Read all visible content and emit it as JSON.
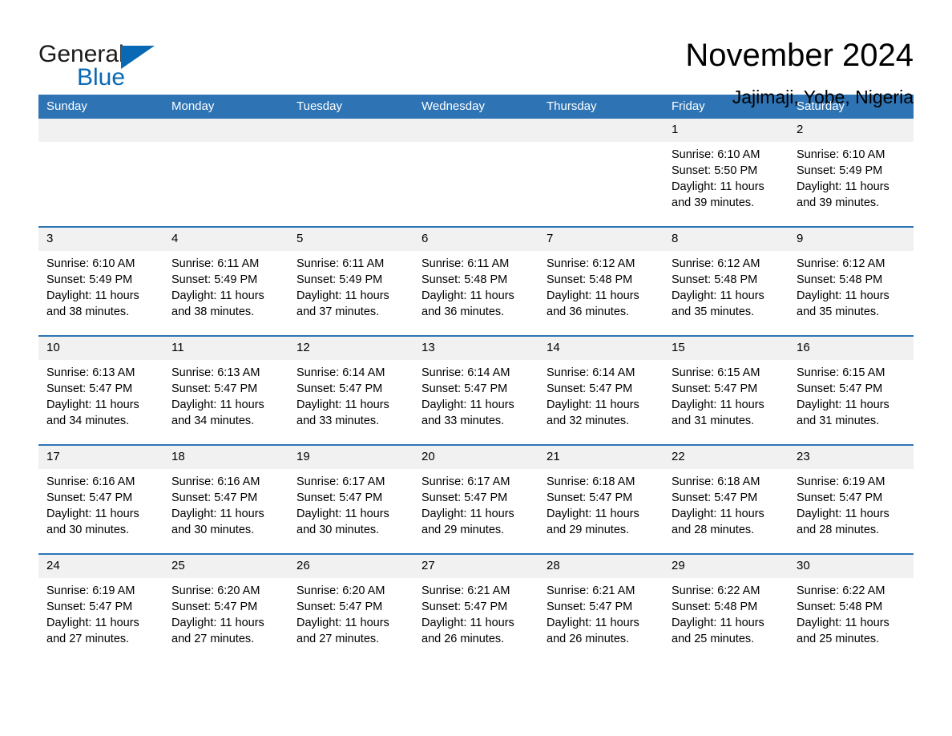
{
  "brand": {
    "word1": "General",
    "word2": "Blue",
    "accent_color": "#0a69b4",
    "triangle_icon": "brand-triangle-icon"
  },
  "header": {
    "month_title": "November 2024",
    "location": "Jajimaji, Yobe, Nigeria"
  },
  "theme": {
    "header_blue": "#2e74b5",
    "daynum_gray": "#f1f1f1",
    "text": "#000000"
  },
  "calendar": {
    "day_names": [
      "Sunday",
      "Monday",
      "Tuesday",
      "Wednesday",
      "Thursday",
      "Friday",
      "Saturday"
    ],
    "weeks": [
      [
        {
          "day": "",
          "lines": []
        },
        {
          "day": "",
          "lines": []
        },
        {
          "day": "",
          "lines": []
        },
        {
          "day": "",
          "lines": []
        },
        {
          "day": "",
          "lines": []
        },
        {
          "day": "1",
          "lines": [
            "Sunrise: 6:10 AM",
            "Sunset: 5:50 PM",
            "Daylight: 11 hours",
            "and 39 minutes."
          ]
        },
        {
          "day": "2",
          "lines": [
            "Sunrise: 6:10 AM",
            "Sunset: 5:49 PM",
            "Daylight: 11 hours",
            "and 39 minutes."
          ]
        }
      ],
      [
        {
          "day": "3",
          "lines": [
            "Sunrise: 6:10 AM",
            "Sunset: 5:49 PM",
            "Daylight: 11 hours",
            "and 38 minutes."
          ]
        },
        {
          "day": "4",
          "lines": [
            "Sunrise: 6:11 AM",
            "Sunset: 5:49 PM",
            "Daylight: 11 hours",
            "and 38 minutes."
          ]
        },
        {
          "day": "5",
          "lines": [
            "Sunrise: 6:11 AM",
            "Sunset: 5:49 PM",
            "Daylight: 11 hours",
            "and 37 minutes."
          ]
        },
        {
          "day": "6",
          "lines": [
            "Sunrise: 6:11 AM",
            "Sunset: 5:48 PM",
            "Daylight: 11 hours",
            "and 36 minutes."
          ]
        },
        {
          "day": "7",
          "lines": [
            "Sunrise: 6:12 AM",
            "Sunset: 5:48 PM",
            "Daylight: 11 hours",
            "and 36 minutes."
          ]
        },
        {
          "day": "8",
          "lines": [
            "Sunrise: 6:12 AM",
            "Sunset: 5:48 PM",
            "Daylight: 11 hours",
            "and 35 minutes."
          ]
        },
        {
          "day": "9",
          "lines": [
            "Sunrise: 6:12 AM",
            "Sunset: 5:48 PM",
            "Daylight: 11 hours",
            "and 35 minutes."
          ]
        }
      ],
      [
        {
          "day": "10",
          "lines": [
            "Sunrise: 6:13 AM",
            "Sunset: 5:47 PM",
            "Daylight: 11 hours",
            "and 34 minutes."
          ]
        },
        {
          "day": "11",
          "lines": [
            "Sunrise: 6:13 AM",
            "Sunset: 5:47 PM",
            "Daylight: 11 hours",
            "and 34 minutes."
          ]
        },
        {
          "day": "12",
          "lines": [
            "Sunrise: 6:14 AM",
            "Sunset: 5:47 PM",
            "Daylight: 11 hours",
            "and 33 minutes."
          ]
        },
        {
          "day": "13",
          "lines": [
            "Sunrise: 6:14 AM",
            "Sunset: 5:47 PM",
            "Daylight: 11 hours",
            "and 33 minutes."
          ]
        },
        {
          "day": "14",
          "lines": [
            "Sunrise: 6:14 AM",
            "Sunset: 5:47 PM",
            "Daylight: 11 hours",
            "and 32 minutes."
          ]
        },
        {
          "day": "15",
          "lines": [
            "Sunrise: 6:15 AM",
            "Sunset: 5:47 PM",
            "Daylight: 11 hours",
            "and 31 minutes."
          ]
        },
        {
          "day": "16",
          "lines": [
            "Sunrise: 6:15 AM",
            "Sunset: 5:47 PM",
            "Daylight: 11 hours",
            "and 31 minutes."
          ]
        }
      ],
      [
        {
          "day": "17",
          "lines": [
            "Sunrise: 6:16 AM",
            "Sunset: 5:47 PM",
            "Daylight: 11 hours",
            "and 30 minutes."
          ]
        },
        {
          "day": "18",
          "lines": [
            "Sunrise: 6:16 AM",
            "Sunset: 5:47 PM",
            "Daylight: 11 hours",
            "and 30 minutes."
          ]
        },
        {
          "day": "19",
          "lines": [
            "Sunrise: 6:17 AM",
            "Sunset: 5:47 PM",
            "Daylight: 11 hours",
            "and 30 minutes."
          ]
        },
        {
          "day": "20",
          "lines": [
            "Sunrise: 6:17 AM",
            "Sunset: 5:47 PM",
            "Daylight: 11 hours",
            "and 29 minutes."
          ]
        },
        {
          "day": "21",
          "lines": [
            "Sunrise: 6:18 AM",
            "Sunset: 5:47 PM",
            "Daylight: 11 hours",
            "and 29 minutes."
          ]
        },
        {
          "day": "22",
          "lines": [
            "Sunrise: 6:18 AM",
            "Sunset: 5:47 PM",
            "Daylight: 11 hours",
            "and 28 minutes."
          ]
        },
        {
          "day": "23",
          "lines": [
            "Sunrise: 6:19 AM",
            "Sunset: 5:47 PM",
            "Daylight: 11 hours",
            "and 28 minutes."
          ]
        }
      ],
      [
        {
          "day": "24",
          "lines": [
            "Sunrise: 6:19 AM",
            "Sunset: 5:47 PM",
            "Daylight: 11 hours",
            "and 27 minutes."
          ]
        },
        {
          "day": "25",
          "lines": [
            "Sunrise: 6:20 AM",
            "Sunset: 5:47 PM",
            "Daylight: 11 hours",
            "and 27 minutes."
          ]
        },
        {
          "day": "26",
          "lines": [
            "Sunrise: 6:20 AM",
            "Sunset: 5:47 PM",
            "Daylight: 11 hours",
            "and 27 minutes."
          ]
        },
        {
          "day": "27",
          "lines": [
            "Sunrise: 6:21 AM",
            "Sunset: 5:47 PM",
            "Daylight: 11 hours",
            "and 26 minutes."
          ]
        },
        {
          "day": "28",
          "lines": [
            "Sunrise: 6:21 AM",
            "Sunset: 5:47 PM",
            "Daylight: 11 hours",
            "and 26 minutes."
          ]
        },
        {
          "day": "29",
          "lines": [
            "Sunrise: 6:22 AM",
            "Sunset: 5:48 PM",
            "Daylight: 11 hours",
            "and 25 minutes."
          ]
        },
        {
          "day": "30",
          "lines": [
            "Sunrise: 6:22 AM",
            "Sunset: 5:48 PM",
            "Daylight: 11 hours",
            "and 25 minutes."
          ]
        }
      ]
    ]
  }
}
